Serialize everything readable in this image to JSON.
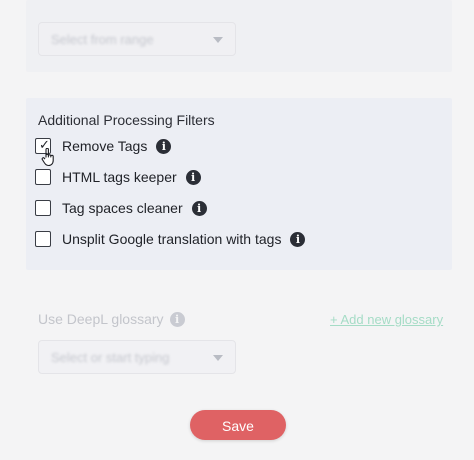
{
  "top_select": {
    "placeholder": "Select from range",
    "icon": "chevron-down-icon"
  },
  "filters": {
    "title": "Additional Processing Filters",
    "options": [
      {
        "label": "Remove Tags",
        "checked": true,
        "icon": "info-icon"
      },
      {
        "label": "HTML tags keeper",
        "checked": false,
        "icon": "info-icon"
      },
      {
        "label": "Tag spaces cleaner",
        "checked": false,
        "icon": "info-icon"
      },
      {
        "label": "Unsplit Google translation with tags",
        "checked": false,
        "icon": "info-icon"
      }
    ]
  },
  "glossary": {
    "label": "Use DeepL glossary",
    "add_link": "+ Add new glossary",
    "select_placeholder": "Select or start typing"
  },
  "actions": {
    "save_label": "Save"
  },
  "colors": {
    "save_button": "#df6264",
    "add_link": "#a5dcc6",
    "panel_bg": "#eceef4"
  }
}
